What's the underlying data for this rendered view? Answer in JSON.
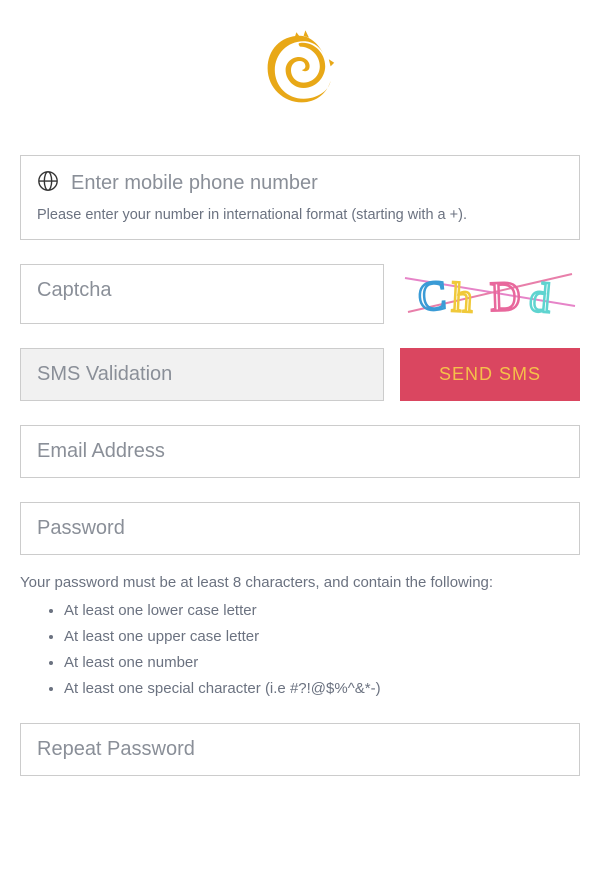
{
  "logo": {
    "name": "dragon-logo",
    "color": "#e8a817"
  },
  "phone": {
    "placeholder": "Enter mobile phone number",
    "hint": "Please enter your number in international format (starting with a +)."
  },
  "captcha": {
    "placeholder": "Captcha",
    "image_text": "ChDd"
  },
  "sms": {
    "placeholder": "SMS Validation",
    "button_label": "SEND SMS"
  },
  "email": {
    "placeholder": "Email Address"
  },
  "password": {
    "placeholder": "Password",
    "hint_intro": "Your password must be at least 8 characters, and contain the following:",
    "rules": [
      "At least one lower case letter",
      "At least one upper case letter",
      "At least one number",
      "At least one special character (i.e #?!@$%^&*-)"
    ]
  },
  "repeat_password": {
    "placeholder": "Repeat Password"
  }
}
